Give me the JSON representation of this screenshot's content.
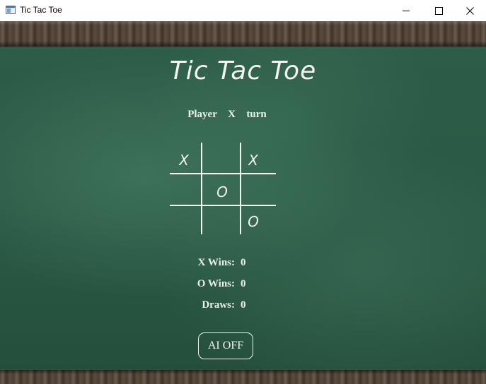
{
  "window": {
    "title": "Tic Tac Toe"
  },
  "game": {
    "title": "Tic Tac Toe",
    "turn_text": "Player  X  turn",
    "board": [
      [
        "X",
        "",
        "X"
      ],
      [
        "",
        "O",
        ""
      ],
      [
        "",
        "",
        "O"
      ]
    ]
  },
  "stats": {
    "x_wins_label": "X Wins:",
    "x_wins": "0",
    "o_wins_label": "O Wins:",
    "o_wins": "0",
    "draws_label": "Draws:",
    "draws": "0"
  },
  "controls": {
    "ai_button_label": "AI OFF"
  },
  "colors": {
    "chalkboard": "#2a5a45",
    "chalk": "#f4f4f0",
    "wood": "#4a3c30"
  }
}
